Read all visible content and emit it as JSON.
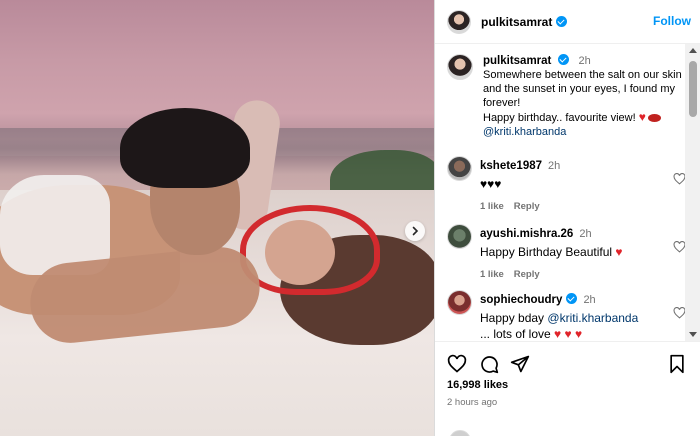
{
  "post": {
    "username": "pulkitsamrat",
    "follow_label": "Follow",
    "caption": {
      "username": "pulkitsamrat",
      "time": "2h",
      "text": "Somewhere between the salt on our skin and the sunset in your eyes, I found my forever!",
      "text2": "Happy birthday.. favourite view!",
      "emoji": "♥",
      "mention": "@kriti.kharbanda"
    },
    "likes": "16,998 likes",
    "posted_ago": "2 hours ago"
  },
  "comments": [
    {
      "username": "kshete1987",
      "time": "2h",
      "text": "♥♥♥",
      "likes": "1 like",
      "reply": "Reply"
    },
    {
      "username": "ayushi.mishra.26",
      "time": "2h",
      "text": "Happy Birthday Beautiful",
      "emoji": "♥",
      "likes": "1 like",
      "reply": "Reply"
    },
    {
      "username": "sophiechoudry",
      "time": "2h",
      "text_prefix": "Happy bday",
      "mention": "@kriti.kharbanda",
      "text_suffix": "... lots of love",
      "emoji": "♥ ♥ ♥"
    }
  ],
  "colors": {
    "accent": "#0095f6",
    "mention": "#00376b",
    "heart": "#e0242a",
    "muted": "#737373"
  }
}
